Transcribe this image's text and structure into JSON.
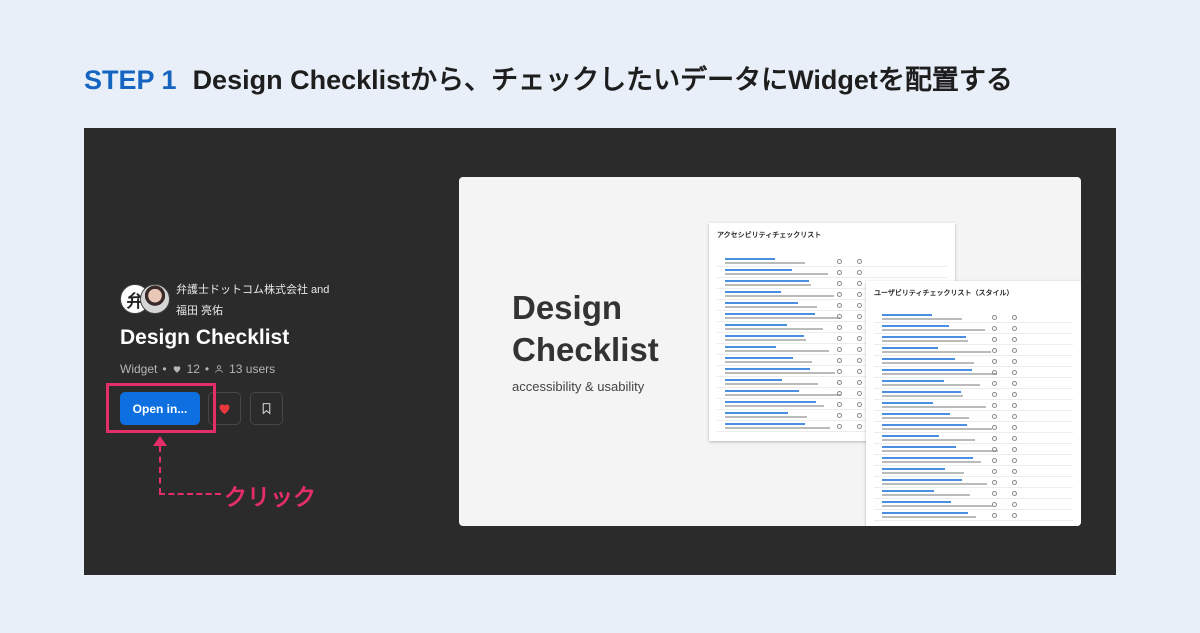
{
  "heading": {
    "step": "STEP 1",
    "text": "Design Checklistから、チェックしたいデータにWidgetを配置する"
  },
  "widget": {
    "avatar_glyph": "弁",
    "author_line1": "弁護士ドットコム株式会社 and",
    "author_line2": "福田 亮佑",
    "title": "Design Checklist",
    "type": "Widget",
    "likes": "12",
    "users": "13 users",
    "open_button": "Open in...",
    "like_icon": "heart-icon",
    "bookmark_icon": "bookmark-icon"
  },
  "annotation": {
    "label": "クリック",
    "color": "#e52e68"
  },
  "preview": {
    "title_line1": "Design",
    "title_line2": "Checklist",
    "subtitle": "accessibility & usability",
    "sheet1_title": "アクセシビリティチェックリスト",
    "sheet2_title": "ユーザビリティチェックリスト（スタイル）"
  },
  "colors": {
    "accent": "#1565c0",
    "button": "#0d6fe0",
    "panel": "#2b2b2b",
    "background": "#e8eff8",
    "heart": "#e8383d"
  }
}
